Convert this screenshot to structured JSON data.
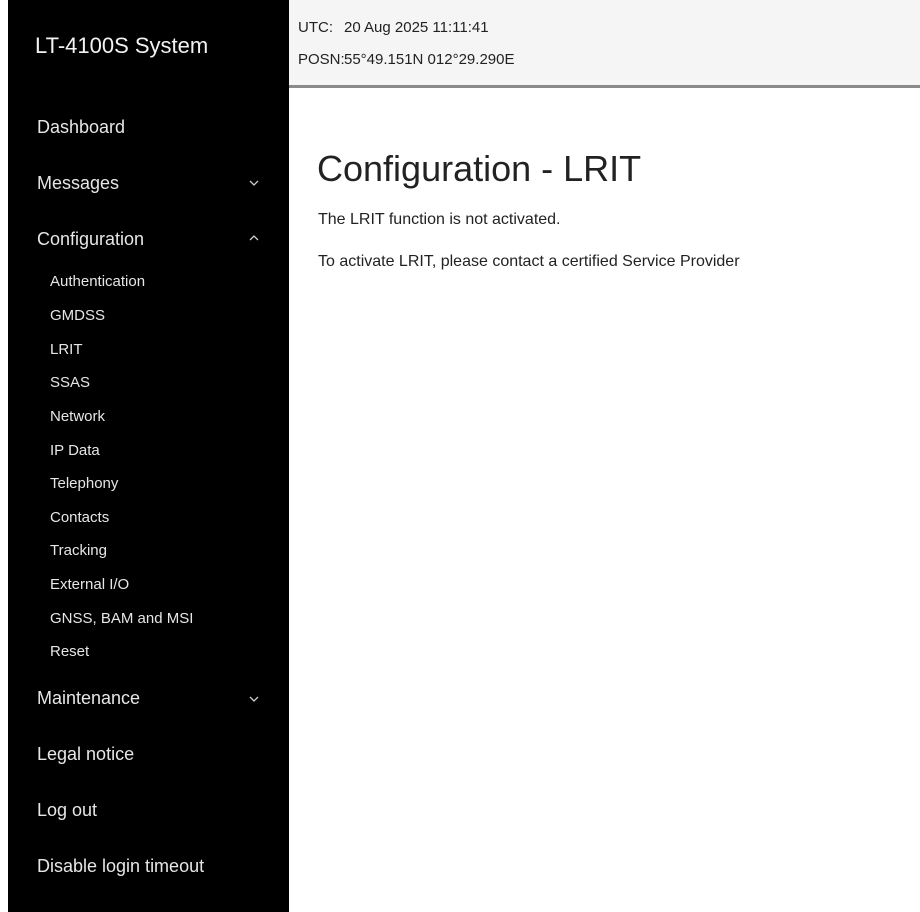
{
  "app": {
    "title": "LT-4100S System"
  },
  "header": {
    "utc_label": "UTC:",
    "utc_value": "20 Aug 2025 11:11:41",
    "posn_label": "POSN:",
    "posn_value": "55°49.151N 012°29.290E"
  },
  "sidebar": {
    "items": [
      {
        "label": "Dashboard",
        "chevron": "none"
      },
      {
        "label": "Messages",
        "chevron": "down"
      },
      {
        "label": "Configuration",
        "chevron": "up"
      },
      {
        "label": "Maintenance",
        "chevron": "down"
      },
      {
        "label": "Legal notice",
        "chevron": "none"
      },
      {
        "label": "Log out",
        "chevron": "none"
      },
      {
        "label": "Disable login timeout",
        "chevron": "none"
      }
    ],
    "config_subitems": [
      "Authentication",
      "GMDSS",
      "LRIT",
      "SSAS",
      "Network",
      "IP Data",
      "Telephony",
      "Contacts",
      "Tracking",
      "External I/O",
      "GNSS, BAM and MSI",
      "Reset"
    ]
  },
  "main": {
    "title": "Configuration - LRIT",
    "line1": "The LRIT function is not activated.",
    "line2": "To activate LRIT, please contact a certified Service Provider"
  },
  "colors": {
    "sidebar_bg": "#000000",
    "sidebar_text": "#e6e6e6",
    "topbar_bg": "#f5f5f5",
    "topbar_border": "#8a8a8a",
    "content_text": "#222222"
  },
  "icons": {
    "chevron_down": "chevron-down-icon",
    "chevron_up": "chevron-up-icon"
  }
}
